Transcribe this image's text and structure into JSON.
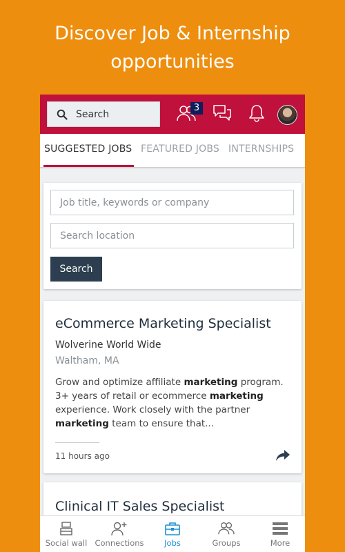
{
  "promo": {
    "line1": "Discover Job & Internship",
    "line2": "opportunities"
  },
  "colors": {
    "background": "#EE8E0F",
    "topbar": "#C0103C",
    "accent_blue": "#1c8fd6",
    "button": "#2c3e50"
  },
  "header": {
    "search_label": "Search",
    "connections_badge": "3",
    "icons": [
      "search-icon",
      "people-icon",
      "chat-icon",
      "bell-icon",
      "avatar"
    ]
  },
  "tabs": [
    {
      "label": "SUGGESTED JOBS",
      "active": true
    },
    {
      "label": "FEATURED JOBS",
      "active": false
    },
    {
      "label": "INTERNSHIPS",
      "active": false
    }
  ],
  "job_search": {
    "keywords_placeholder": "Job title, keywords or company",
    "location_placeholder": "Search location",
    "button_label": "Search"
  },
  "jobs": [
    {
      "title": "eCommerce Marketing Specialist",
      "company": "Wolverine World Wide",
      "location": "Waltham, MA",
      "description": [
        {
          "text": "Grow and optimize affiliate ",
          "bold": false
        },
        {
          "text": "marketing",
          "bold": true
        },
        {
          "text": " program. 3+ years of retail or ecommerce ",
          "bold": false
        },
        {
          "text": "marketing",
          "bold": true
        },
        {
          "text": " experience. Work closely with the partner ",
          "bold": false
        },
        {
          "text": "marketing",
          "bold": true
        },
        {
          "text": " team to ensure that...",
          "bold": false
        }
      ],
      "posted": "11 hours ago"
    },
    {
      "title": "Clinical IT Sales Specialist"
    }
  ],
  "bottom_nav": [
    {
      "label": "Social wall",
      "icon": "social-wall-icon",
      "active": false
    },
    {
      "label": "Connections",
      "icon": "add-connection-icon",
      "active": false
    },
    {
      "label": "Jobs",
      "icon": "briefcase-icon",
      "active": true
    },
    {
      "label": "Groups",
      "icon": "groups-icon",
      "active": false
    },
    {
      "label": "More",
      "icon": "menu-icon",
      "active": false
    }
  ]
}
